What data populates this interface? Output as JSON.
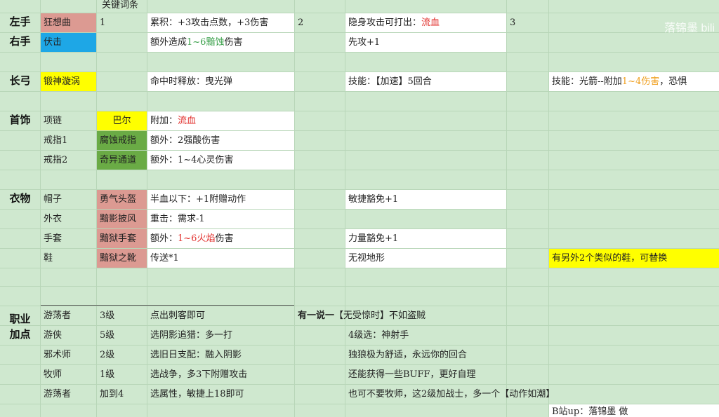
{
  "header": {
    "keywords_label": "关键词条"
  },
  "watermark": "落锦墨 bili",
  "credit": "B站up：落锦墨 做",
  "sections": {
    "left_hand": "左手",
    "right_hand": "右手",
    "longbow": "长弓",
    "jewelry": "首饰",
    "clothing": "衣物",
    "class_points": "职业加点"
  },
  "rows": {
    "left": {
      "item": "狂想曲",
      "col_num": "1",
      "desc1": "累积：+3攻击点数，+3伤害",
      "num2": "2",
      "desc2_pre": "隐身攻击可打出：",
      "desc2_red": "流血",
      "num3": "3"
    },
    "right": {
      "item": "伏击",
      "desc1_pre": "额外造成",
      "desc1_green": "1~6黯蚀",
      "desc1_post": "伤害",
      "desc2": "先攻+1"
    },
    "bow": {
      "item": "锻神漩涡",
      "desc1": "命中时释放：曳光弹",
      "desc2": "技能：【加速】5回合",
      "desc3_pre": "技能：光箭--附加",
      "desc3_orange": "1~4伤害",
      "desc3_post": "，恐惧"
    },
    "necklace": {
      "slot": "项链",
      "item": "巴尔",
      "desc_pre": "附加：",
      "desc_red": "流血"
    },
    "ring1": {
      "slot": "戒指1",
      "item": "腐蚀戒指",
      "desc": "额外：2强酸伤害"
    },
    "ring2": {
      "slot": "戒指2",
      "item": "奇异通道",
      "desc": "额外：1~4心灵伤害"
    },
    "hat": {
      "slot": "帽子",
      "item": "勇气头盔",
      "desc1": "半血以下：+1附赠动作",
      "desc2": "敏捷豁免+1"
    },
    "cloak": {
      "slot": "外衣",
      "item": "黯影披风",
      "desc1": "重击：需求-1"
    },
    "gloves": {
      "slot": "手套",
      "item": "黯狱手套",
      "desc1_pre": "额外：",
      "desc1_red": "1~6火焰",
      "desc1_post": "伤害",
      "desc2": "力量豁免+1"
    },
    "boots": {
      "slot": "鞋",
      "item": "黯狱之靴",
      "desc1": "传送*1",
      "desc2": "无视地形",
      "note": "有另外2个类似的鞋，可替换"
    }
  },
  "classes": [
    {
      "name": "游荡者",
      "level": "3级",
      "choice": "点出刺客即可",
      "note_bold": "有一说一",
      "note": "【无受惊时】不如盗贼"
    },
    {
      "name": "游侠",
      "level": "5级",
      "choice": "选阴影追猎：多一打",
      "note": "4级选：神射手"
    },
    {
      "name": "邪术师",
      "level": "2级",
      "choice": "选旧日支配：融入阴影",
      "note": "独狼极为舒适，永远你的回合"
    },
    {
      "name": "牧师",
      "level": "1级",
      "choice": "选战争，多3下附赠攻击",
      "note": "还能获得一些BUFF，更好自理"
    },
    {
      "name": "游荡者",
      "level": "加到4",
      "choice": "选属性，敏捷上18即可",
      "note": "也可不要牧师，这2级加战士，多一个【动作如潮】"
    }
  ],
  "colors": {
    "sheet_bg": "#cfe8cf",
    "pink": "#dc9a92",
    "blue": "#1ea7e6",
    "yellow": "#ffff00",
    "green": "#6aab45",
    "red_text": "#e2312e",
    "green_text": "#3aa04a",
    "orange_text": "#f0a020"
  }
}
